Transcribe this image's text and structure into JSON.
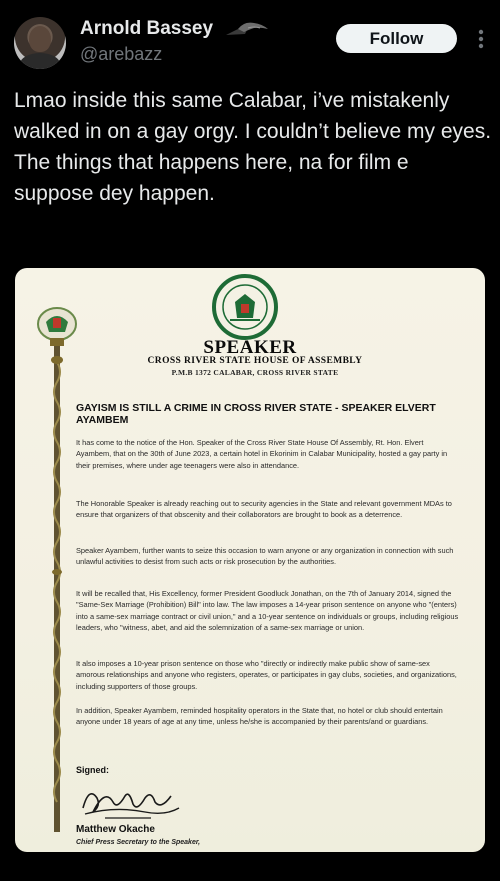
{
  "author": {
    "name": "Arnold Bassey",
    "handle": "@arebazz",
    "name_emoji": "bird-emoji"
  },
  "actions": {
    "follow_label": "Follow",
    "more_icon": "more-dots-icon"
  },
  "tweet": {
    "text": "Lmao inside this same Calabar, i’ve mistakenly walked in on a gay orgy. I couldn’t believe my eyes. The things that happens here, na for film e suppose dey happen."
  },
  "document": {
    "title": "SPEAKER",
    "subtitle": "CROSS RIVER STATE HOUSE OF ASSEMBLY",
    "address": "P.M.B 1372 CALABAR, CROSS RIVER STATE",
    "headline": "GAYISM IS STILL A CRIME IN CROSS RIVER STATE - SPEAKER ELVERT AYAMBEM",
    "paragraphs": [
      "It has come to the notice of the Hon. Speaker of the Cross River State House Of Assembly, Rt. Hon. Elvert Ayambem, that on the 30th of June 2023, a certain hotel in Ekorinim in Calabar Municipality, hosted a gay party in their premises, where under age teenagers were also in attendance.",
      "The Honorable Speaker is already reaching out to security agencies in the State and relevant government MDAs to ensure that organizers of that obscenity and their collaborators are brought to book as a deterrence.",
      "Speaker Ayambem, further wants to seize this occasion to warn anyone or any organization in connection with such unlawful activities to desist from such acts or risk prosecution by the authorities.",
      "It will be recalled that, His Excellency, former President Goodluck Jonathan, on the 7th of January 2014, signed the \"Same-Sex Marriage (Prohibition) Bill\" into law. The law imposes a 14-year prison sentence on anyone who \"(enters) into a same-sex marriage contract or civil union,\" and a 10-year sentence on individuals or groups, including religious leaders, who \"witness, abet, and aid the solemnization of a same-sex marriage or union.",
      "It also imposes a 10-year prison sentence on those who \"directly or indirectly make public show of same-sex amorous relationships and anyone who registers, operates, or participates in gay clubs, societies, and organizations, including supporters of those groups.",
      "In addition, Speaker Ayambem, reminded hospitality operators in the State that, no hotel or club should entertain anyone under 18 years of age at any time, unless he/she is accompanied by their parents/and or guardians."
    ],
    "signed_label": "Signed:",
    "signer_name": "Matthew Okache",
    "signer_role": "Chief Press Secretary to the Speaker,",
    "seal_text": "CROSS RIVER STATE HOUSE OF ASSEMBLY",
    "colors": {
      "seal_green": "#1e6b36",
      "mace_gold": "#7d6a2c"
    }
  }
}
